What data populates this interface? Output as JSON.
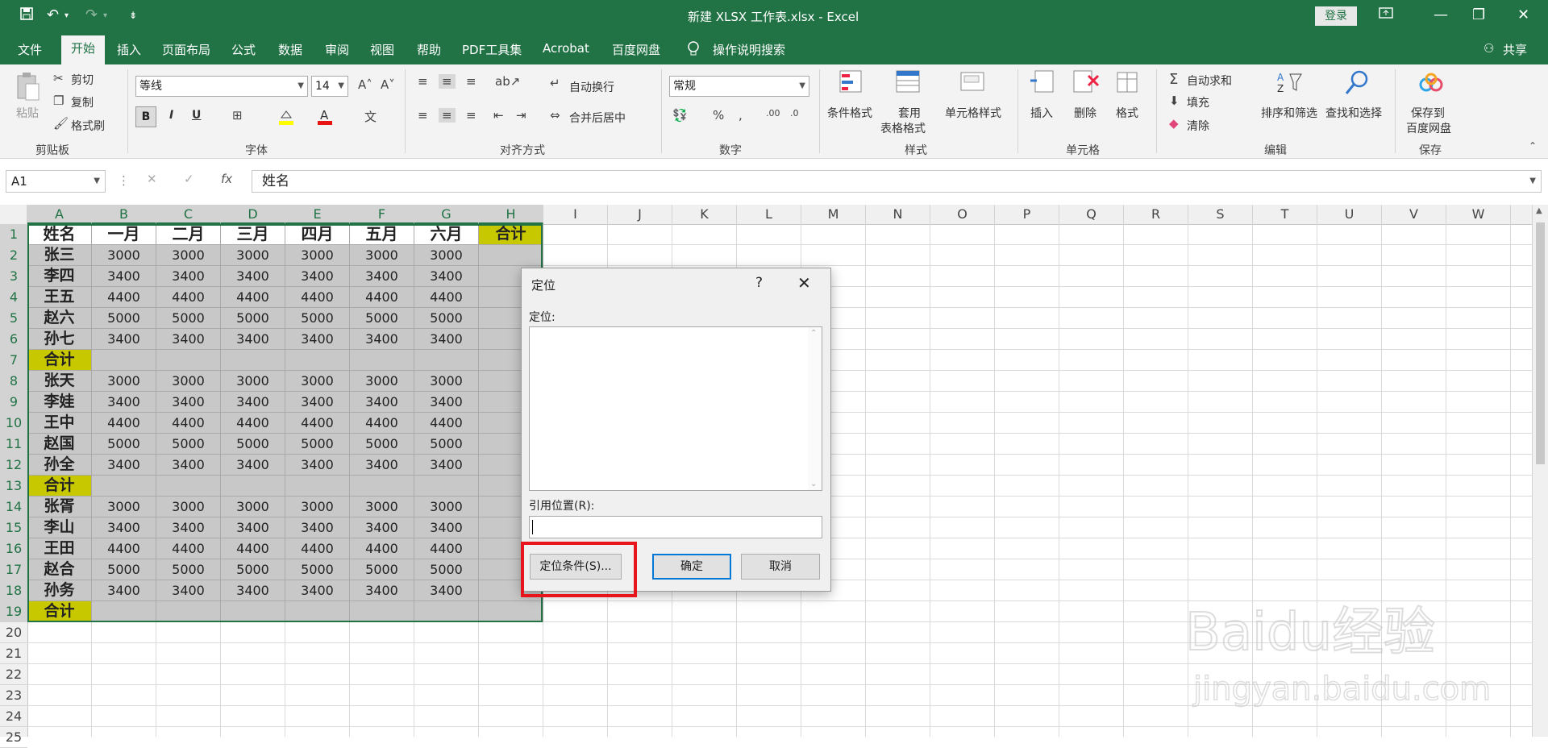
{
  "window": {
    "title": "新建 XLSX 工作表.xlsx  -  Excel",
    "login_label": "登录",
    "share_label": "共享"
  },
  "menu": {
    "items": [
      "文件",
      "开始",
      "插入",
      "页面布局",
      "公式",
      "数据",
      "审阅",
      "视图",
      "帮助",
      "PDF工具集",
      "Acrobat",
      "百度网盘"
    ],
    "active": "开始",
    "tell_me": "操作说明搜索"
  },
  "ribbon": {
    "clipboard": {
      "label": "剪贴板",
      "paste": "粘贴",
      "cut": "剪切",
      "copy": "复制",
      "format_painter": "格式刷"
    },
    "font": {
      "label": "字体",
      "font_name": "等线",
      "font_size": "14",
      "bold": "B",
      "italic": "I",
      "underline": "U"
    },
    "alignment": {
      "label": "对齐方式",
      "wrap_text": "自动换行",
      "merge_center": "合并后居中"
    },
    "number": {
      "label": "数字",
      "format": "常规"
    },
    "styles": {
      "label": "样式",
      "conditional": "条件格式",
      "table_format_1": "套用",
      "table_format_2": "表格格式",
      "cell_styles": "单元格样式"
    },
    "cells": {
      "label": "单元格",
      "insert": "插入",
      "delete": "删除",
      "format": "格式"
    },
    "editing": {
      "label": "编辑",
      "autosum": "自动求和",
      "fill": "填充",
      "clear": "清除",
      "sort_filter": "排序和筛选",
      "find_select": "查找和选择"
    },
    "save": {
      "label": "保存",
      "save_to_1": "保存到",
      "save_to_2": "百度网盘"
    }
  },
  "formula_bar": {
    "name_box": "A1",
    "fx": "fx",
    "content": "姓名"
  },
  "grid": {
    "columns": [
      "A",
      "B",
      "C",
      "D",
      "E",
      "F",
      "G",
      "H",
      "I",
      "J",
      "K",
      "L",
      "M",
      "N",
      "O",
      "P",
      "Q",
      "R",
      "S",
      "T",
      "U",
      "V",
      "W"
    ],
    "rows": [
      "1",
      "2",
      "3",
      "4",
      "5",
      "6",
      "7",
      "8",
      "9",
      "10",
      "11",
      "12",
      "13",
      "14",
      "15",
      "16",
      "17",
      "18",
      "19",
      "20",
      "21",
      "22",
      "23",
      "24",
      "25"
    ],
    "header_row": [
      "姓名",
      "一月",
      "二月",
      "三月",
      "四月",
      "五月",
      "六月",
      "合计"
    ],
    "data_rows": [
      [
        "张三",
        "3000",
        "3000",
        "3000",
        "3000",
        "3000",
        "3000",
        ""
      ],
      [
        "李四",
        "3400",
        "3400",
        "3400",
        "3400",
        "3400",
        "3400",
        ""
      ],
      [
        "王五",
        "4400",
        "4400",
        "4400",
        "4400",
        "4400",
        "4400",
        ""
      ],
      [
        "赵六",
        "5000",
        "5000",
        "5000",
        "5000",
        "5000",
        "5000",
        ""
      ],
      [
        "孙七",
        "3400",
        "3400",
        "3400",
        "3400",
        "3400",
        "3400",
        ""
      ],
      [
        "合计",
        "",
        "",
        "",
        "",
        "",
        "",
        ""
      ],
      [
        "张天",
        "3000",
        "3000",
        "3000",
        "3000",
        "3000",
        "3000",
        ""
      ],
      [
        "李娃",
        "3400",
        "3400",
        "3400",
        "3400",
        "3400",
        "3400",
        ""
      ],
      [
        "王中",
        "4400",
        "4400",
        "4400",
        "4400",
        "4400",
        "4400",
        ""
      ],
      [
        "赵国",
        "5000",
        "5000",
        "5000",
        "5000",
        "5000",
        "5000",
        ""
      ],
      [
        "孙全",
        "3400",
        "3400",
        "3400",
        "3400",
        "3400",
        "3400",
        ""
      ],
      [
        "合计",
        "",
        "",
        "",
        "",
        "",
        "",
        ""
      ],
      [
        "张胥",
        "3000",
        "3000",
        "3000",
        "3000",
        "3000",
        "3000",
        ""
      ],
      [
        "李山",
        "3400",
        "3400",
        "3400",
        "3400",
        "3400",
        "3400",
        ""
      ],
      [
        "王田",
        "4400",
        "4400",
        "4400",
        "4400",
        "4400",
        "4400",
        ""
      ],
      [
        "赵合",
        "5000",
        "5000",
        "5000",
        "5000",
        "5000",
        "5000",
        ""
      ],
      [
        "孙务",
        "3400",
        "3400",
        "3400",
        "3400",
        "3400",
        "3400",
        ""
      ],
      [
        "合计",
        "",
        "",
        "",
        "",
        "",
        "",
        ""
      ]
    ]
  },
  "dialog": {
    "title": "定位",
    "help": "?",
    "list_label": "定位:",
    "ref_label": "引用位置(R):",
    "ref_value": "",
    "special_button": "定位条件(S)...",
    "ok_button": "确定",
    "cancel_button": "取消"
  },
  "colors": {
    "excel_green": "#217346",
    "highlight_yellow": "#c8c800",
    "selection_gray": "#c8c8c8",
    "callout_red": "#e8141c"
  },
  "watermark": {
    "text_1": "Baidu经验",
    "text_2": "jingyan.baidu.com"
  }
}
